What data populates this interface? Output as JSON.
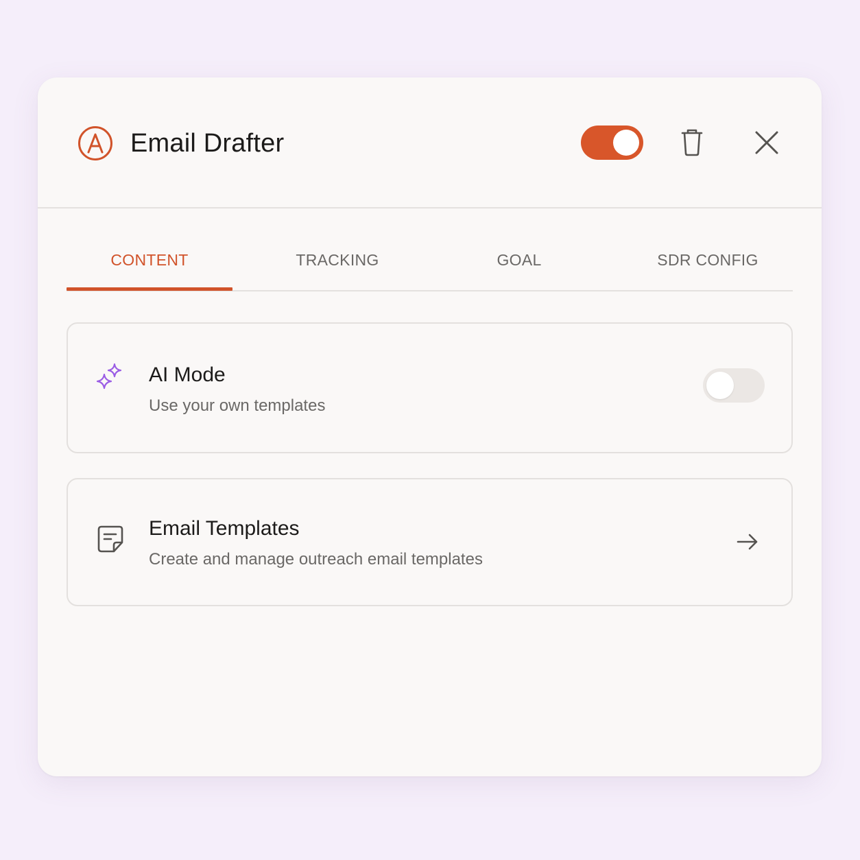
{
  "header": {
    "title": "Email Drafter",
    "logo_icon": "anthropic-a-circle-icon",
    "enabled": true,
    "actions": [
      "trash-icon",
      "close-icon"
    ]
  },
  "tabs": [
    {
      "label": "CONTENT",
      "active": true
    },
    {
      "label": "TRACKING",
      "active": false
    },
    {
      "label": "GOAL",
      "active": false
    },
    {
      "label": "SDR CONFIG",
      "active": false
    }
  ],
  "cards": {
    "ai_mode": {
      "icon": "sparkles-icon",
      "title": "AI Mode",
      "subtitle": "Use your own templates",
      "enabled": false
    },
    "email_templates": {
      "icon": "document-icon",
      "title": "Email Templates",
      "subtitle": "Create and manage outreach email templates",
      "action_icon": "arrow-right-icon"
    }
  },
  "colors": {
    "accent": "#d1532a",
    "toggle_on": "#d8562a",
    "sparkle": "#9b5de5",
    "background": "#f5eefa",
    "panel": "#faf8f7"
  }
}
